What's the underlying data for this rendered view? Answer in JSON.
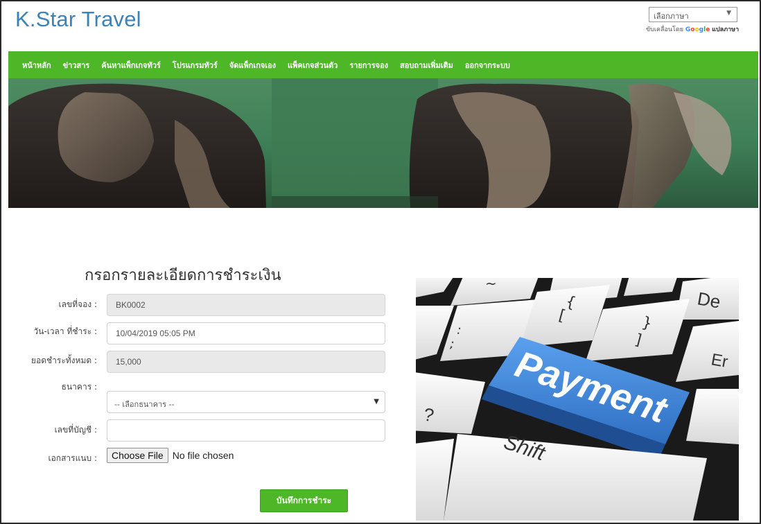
{
  "header": {
    "brand": "K.Star Travel",
    "language_select_value": "เลือกภาษา",
    "powered_by_text": "ขับเคลื่อนโดย",
    "google_letters": [
      "G",
      "o",
      "o",
      "g",
      "l",
      "e"
    ],
    "translate_text": "แปลภาษา"
  },
  "nav": {
    "items": [
      "หน้าหลัก",
      "ข่าวสาร",
      "ค้นหาแพ็กเกจทัวร์",
      "โปรแกรมทัวร์",
      "จัดแพ็กเกจเอง",
      "แพ็คเกจส่วนตัว",
      "รายการจอง",
      "สอบถามเพิ่มเติม",
      "ออกจากระบบ"
    ],
    "background_color": "#4eb728"
  },
  "form": {
    "title": "กรอกรายละเอียดการชำระเงิน",
    "booking_no_label": "เลขที่จอง :",
    "booking_no_value": "BK0002",
    "paid_datetime_label": "วัน-เวลา ที่ชำระ :",
    "paid_datetime_value": "10/04/2019 05:05 PM",
    "total_label": "ยอดชำระทั้งหมด :",
    "total_value": "15,000",
    "bank_label": "ธนาคาร :",
    "bank_select_value": "-- เลือกธนาคาร --",
    "account_label": "เลขที่บัญชี :",
    "account_value": "",
    "attachment_label": "เอกสารแนบ :",
    "choose_file_label": "Choose File",
    "file_status": "No file chosen",
    "submit_label": "บันทึกการชำระ"
  },
  "payment_image": {
    "key_main": "Payment",
    "key_shift": "Shift",
    "key_del": "De",
    "key_enter": "Er",
    "key_tilde": "~",
    "key_bracket_open": "{",
    "key_bracket_open_lower": "[",
    "key_bracket_close": "}",
    "key_bracket_close_lower": "]",
    "key_question": "?",
    "key_colon": ":",
    "key_semicolon": ";",
    "accent_color": "#3d7fd6"
  }
}
